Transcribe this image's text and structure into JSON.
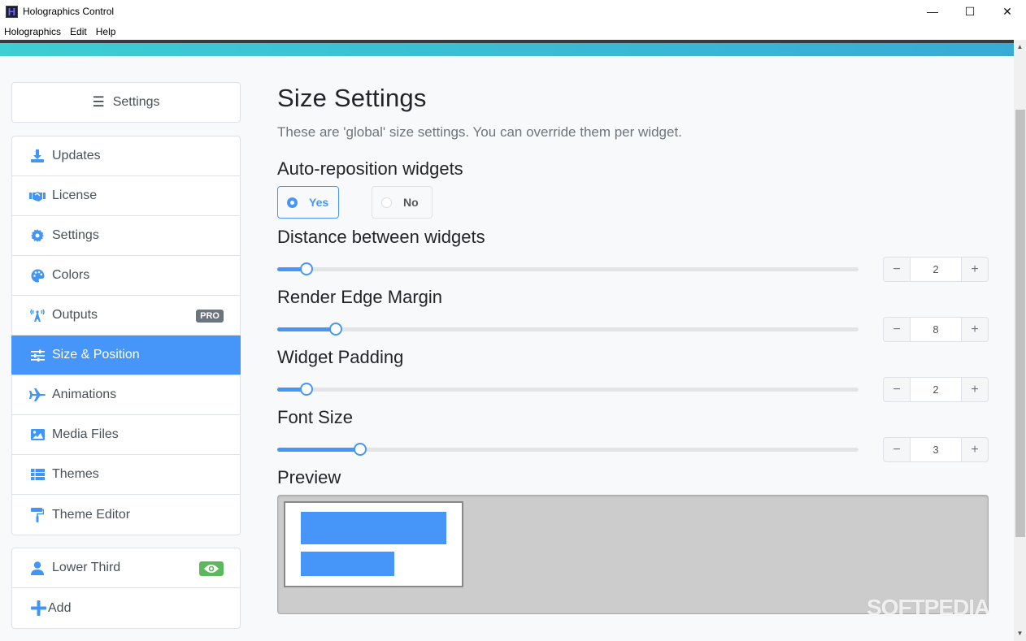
{
  "window": {
    "title": "Holographics Control",
    "controls": {
      "minimize": "—",
      "maximize": "☐",
      "close": "✕"
    }
  },
  "menu": [
    "Holographics",
    "Edit",
    "Help"
  ],
  "sidebar": {
    "header_label": "Settings",
    "items": [
      {
        "label": "Updates",
        "icon": "download-icon"
      },
      {
        "label": "License",
        "icon": "handshake-icon"
      },
      {
        "label": "Settings",
        "icon": "gear-icon"
      },
      {
        "label": "Colors",
        "icon": "palette-icon"
      },
      {
        "label": "Outputs",
        "icon": "broadcast-icon",
        "badge": "PRO"
      },
      {
        "label": "Size & Position",
        "icon": "sliders-icon",
        "active": true
      },
      {
        "label": "Animations",
        "icon": "plane-icon"
      },
      {
        "label": "Media Files",
        "icon": "image-icon"
      },
      {
        "label": "Themes",
        "icon": "table-list-icon"
      },
      {
        "label": "Theme Editor",
        "icon": "paint-roller-icon"
      }
    ],
    "widgets": [
      {
        "label": "Lower Third",
        "icon": "user-icon",
        "visible": true
      }
    ],
    "add_label": "Add"
  },
  "main": {
    "title": "Size Settings",
    "subtitle": "These are 'global' size settings. You can override them per widget.",
    "auto_reposition": {
      "label": "Auto-reposition widgets",
      "options": [
        "Yes",
        "No"
      ],
      "selected": "Yes"
    },
    "settings": [
      {
        "label": "Distance between widgets",
        "value": "2",
        "fraction": 0.05
      },
      {
        "label": "Render Edge Margin",
        "value": "8",
        "fraction": 0.1
      },
      {
        "label": "Widget Padding",
        "value": "2",
        "fraction": 0.05
      },
      {
        "label": "Font Size",
        "value": "3",
        "fraction": 0.143
      }
    ],
    "stepper": {
      "decrement": "−",
      "increment": "+"
    },
    "preview_label": "Preview"
  },
  "colors": {
    "accent": "#4696fa",
    "gradient_start": "#3ccfd3",
    "gradient_end": "#37abd5",
    "badge_pro": "#6c757d",
    "badge_visible": "#5cb85c"
  },
  "watermark": "SOFTPEDIA"
}
